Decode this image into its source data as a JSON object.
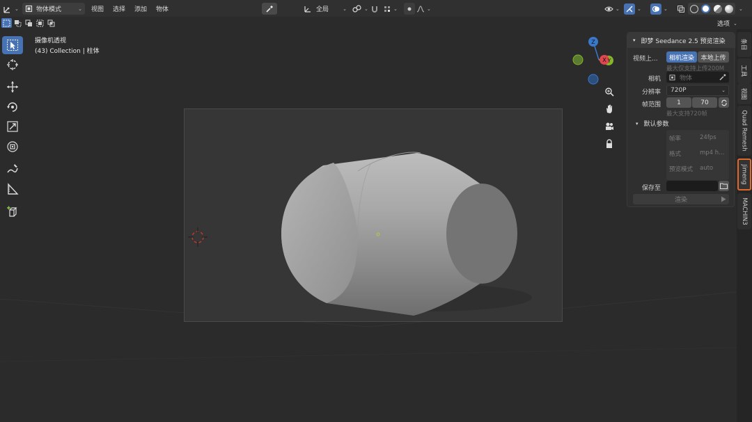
{
  "header": {
    "mode_label": "物体模式",
    "menus": [
      "视图",
      "选择",
      "添加",
      "物体"
    ],
    "transform_orientation": "全局",
    "options_label": "选项"
  },
  "viewport": {
    "view_name": "摄像机透视",
    "collection_info": "(43) Collection | 柱体",
    "axis_x": "X",
    "axis_y": "Y",
    "axis_z": "Z"
  },
  "panel": {
    "title": "即梦 Seedance 2.5 预览渲染",
    "video_upload_label": "视频上...",
    "btn_camera_render": "相机渲染",
    "btn_local_upload": "本地上传",
    "upload_hint": "最大仅支持上传200M",
    "camera_label": "相机",
    "camera_placeholder": "物体",
    "resolution_label": "分辨率",
    "resolution_value": "720P",
    "frame_range_label": "帧范围",
    "frame_start": "1",
    "frame_end": "70",
    "frame_hint": "最大支持720帧",
    "defaults_header": "默认参数",
    "fps_label": "帧率",
    "fps_value": "24fps",
    "format_label": "格式",
    "format_value": "mp4 h...",
    "preview_mode_label": "预览模式",
    "preview_mode_value": "auto",
    "save_to_label": "保存至",
    "render_button": "渲染"
  },
  "right_tabs": [
    "条目",
    "工具",
    "视图",
    "Quad Remesh",
    "Jimeng",
    "MACHIN3"
  ],
  "colors": {
    "accent_blue": "#4772b3",
    "active_tab_outline": "#e06a2c",
    "axis_x": "#e0464f",
    "axis_y": "#86b52a",
    "axis_z": "#3a78cc"
  }
}
